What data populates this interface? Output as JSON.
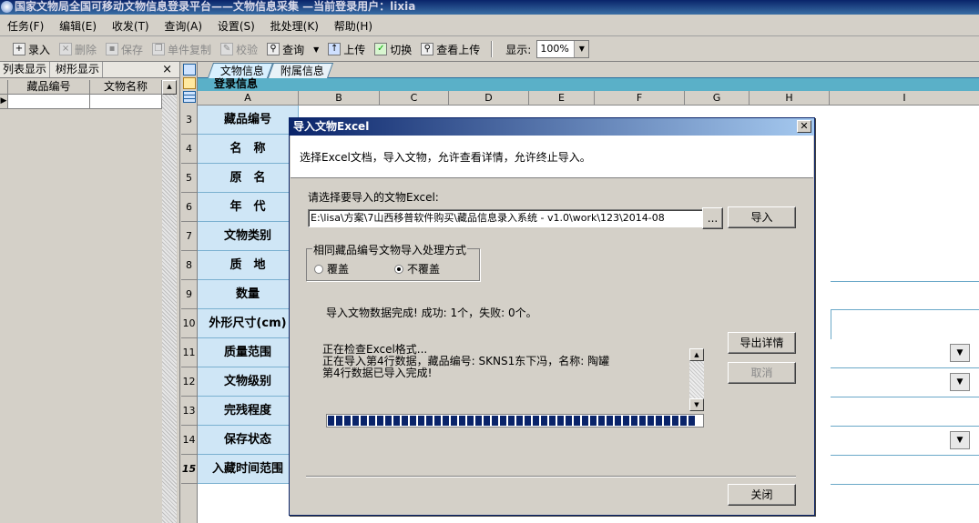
{
  "window": {
    "title": "国家文物局全国可移动文物信息登录平台——文物信息采集 —当前登录用户：lixia"
  },
  "menu": [
    "任务(F)",
    "编辑(E)",
    "收发(T)",
    "查询(A)",
    "设置(S)",
    "批处理(K)",
    "帮助(H)"
  ],
  "toolbar": {
    "buttons": [
      {
        "label": "录入",
        "icon": "add-record-icon",
        "enabled": true
      },
      {
        "label": "删除",
        "icon": "delete-icon",
        "enabled": false
      },
      {
        "label": "保存",
        "icon": "save-icon",
        "enabled": false
      },
      {
        "label": "单件复制",
        "icon": "copy-icon",
        "enabled": false
      },
      {
        "label": "校验",
        "icon": "validate-icon",
        "enabled": false
      },
      {
        "label": "查询",
        "icon": "search-icon",
        "enabled": true
      },
      {
        "label": "上传",
        "icon": "upload-icon",
        "enabled": true
      },
      {
        "label": "切换",
        "icon": "switch-icon",
        "enabled": true
      },
      {
        "label": "查看上传",
        "icon": "view-upload-icon",
        "enabled": true
      }
    ],
    "zoom_label": "显示:",
    "zoom_value": "100%"
  },
  "left_panel": {
    "tabs": [
      "列表显示",
      "树形显示"
    ],
    "columns": [
      "藏品编号",
      "文物名称"
    ]
  },
  "sheet_tabs": [
    "文物信息",
    "附属信息"
  ],
  "section_title": "登录信息",
  "columns": [
    "A",
    "B",
    "C",
    "D",
    "E",
    "F",
    "G",
    "H",
    "I"
  ],
  "rows": [
    {
      "num": "3",
      "label": "藏品编号"
    },
    {
      "num": "4",
      "label": "名　称"
    },
    {
      "num": "5",
      "label": "原　名"
    },
    {
      "num": "6",
      "label": "年　代"
    },
    {
      "num": "7",
      "label": "文物类别"
    },
    {
      "num": "8",
      "label": "质　地"
    },
    {
      "num": "9",
      "label": "数量"
    },
    {
      "num": "10",
      "label": "外形尺寸(cm)"
    },
    {
      "num": "11",
      "label": "质量范围"
    },
    {
      "num": "12",
      "label": "文物级别"
    },
    {
      "num": "13",
      "label": "完残程度"
    },
    {
      "num": "14",
      "label": "保存状态"
    },
    {
      "num": "15",
      "label": "入藏时间范围"
    }
  ],
  "dialog": {
    "title": "导入文物Excel",
    "description": "选择Excel文档，导入文物，允许查看详情，允许终止导入。",
    "file_label": "请选择要导入的文物Excel:",
    "file_path": "E:\\lisa\\方案\\7山西移普软件购买\\藏品信息录入系统 - v1.0\\work\\123\\2014-08",
    "browse": "...",
    "import": "导入",
    "group_title": "相同藏品编号文物导入处理方式",
    "option_overwrite": "覆盖",
    "option_keep": "不覆盖",
    "selected_option": "不覆盖",
    "status": "导入文物数据完成! 成功: 1个，失败: 0个。",
    "log": [
      "正在检查Excel格式...",
      "正在导入第4行数据，藏品编号: SKNS1东下冯，名称: 陶罐",
      "第4行数据已导入完成!"
    ],
    "progress": 1.0,
    "export_details": "导出详情",
    "cancel": "取消",
    "close": "关闭"
  }
}
